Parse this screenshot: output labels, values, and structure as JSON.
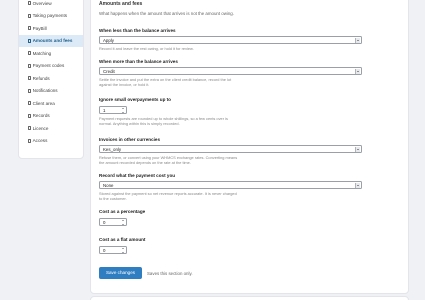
{
  "sidebar": {
    "items": [
      {
        "label": "Overview"
      },
      {
        "label": "Taking payments"
      },
      {
        "label": "PayBill"
      },
      {
        "label": "Amounts and fees",
        "active": true
      },
      {
        "label": "Matching"
      },
      {
        "label": "Payment codes"
      },
      {
        "label": "Refunds"
      },
      {
        "label": "Notifications"
      },
      {
        "label": "Client area"
      },
      {
        "label": "Records"
      },
      {
        "label": "Licence"
      },
      {
        "label": "Access"
      }
    ]
  },
  "section": {
    "title": "Amounts and fees",
    "intro": "What happens when the amount that arrives is not the amount owing."
  },
  "fields": {
    "less_than_balance": {
      "label": "When less than the balance arrives",
      "value": "Apply",
      "help": "Record it and leave the rest owing, or hold it for review."
    },
    "more_than_balance": {
      "label": "When more than the balance arrives",
      "value": "Credit",
      "help1": "Settle the invoice and put the extra on the client credit balance, record the lot",
      "help2": "against the invoice, or hold it."
    },
    "ignore_overpayments": {
      "label": "Ignore small overpayments up to",
      "value": "1",
      "help1": "Payment requests are rounded up to whole shillings, so a few cents over is",
      "help2": "normal. Anything within this is simply recorded."
    },
    "other_currencies": {
      "label": "Invoices in other currencies",
      "value": "Kes_only",
      "help1": "Refuse them, or convert using your WHMCS exchange rates. Converting means",
      "help2": "the amount recorded depends on the rate at the time."
    },
    "payment_cost": {
      "label": "Record what the payment cost you",
      "value": "None",
      "help1": "Stored against the payment so net revenue reports accurate. It is never charged",
      "help2": "to the customer."
    },
    "cost_percentage": {
      "label": "Cost as a percentage",
      "value": "0"
    },
    "cost_flat": {
      "label": "Cost as a flat amount",
      "value": "0"
    }
  },
  "actions": {
    "save_label": "Save changes",
    "save_hint": "Saves this section only."
  }
}
